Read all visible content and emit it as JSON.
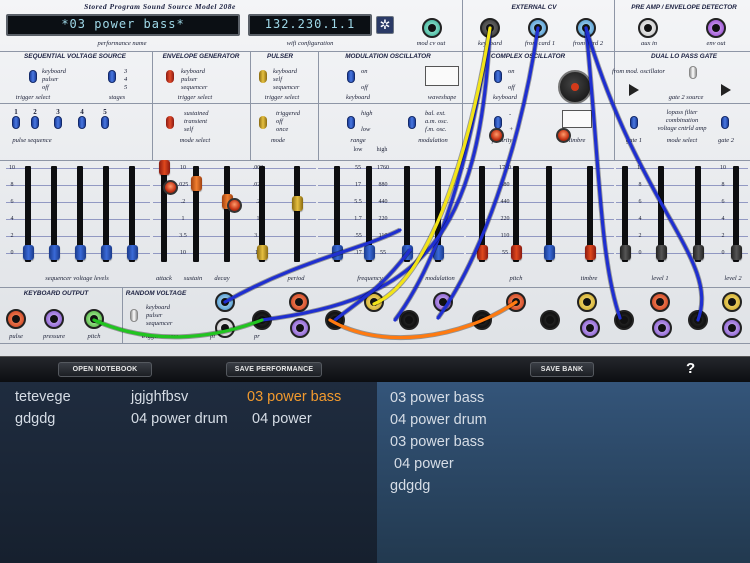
{
  "header": {
    "title": "Stored Program Sound Source Model 208e",
    "performance_name": "*03 power bass*",
    "performance_caption": "performance name",
    "wifi_address": "132.230.1.1",
    "wifi_caption": "wifi configuration",
    "gear_glyph": "✲",
    "mod_cv_out": "mod cv out"
  },
  "sections": {
    "external_cv": "EXTERNAL CV",
    "keyboard": "keyboard",
    "from_card_1": "from card 1",
    "from_card_2": "from card 2",
    "preamp": "PRE AMP / ENVELOPE DETECTOR",
    "aux_in": "aux in",
    "env_out": "env out",
    "dual_lopass": "DUAL LO PASS GATE",
    "from_mod_osc": "from mod. oscillator",
    "gate_2_source": "gate 2 source",
    "lopass_filter": "lopass filter",
    "combination": "combination",
    "vca": "voltage cntrld amp",
    "gate_1": "gate 1",
    "mode_select_lpg": "mode select",
    "gate_2": "gate 2",
    "seq_voltage_source": "SEQUENTIAL VOLTAGE SOURCE",
    "seq_keyboard": "keyboard",
    "seq_pulser": "pulser",
    "seq_off": "off",
    "trigger_select": "trigger select",
    "stage_3": "3",
    "stage_4": "4",
    "stage_5": "5",
    "stages": "stages",
    "pulse_sequence": "pulse sequence",
    "pulse_nums": [
      "1",
      "2",
      "3",
      "4",
      "5"
    ],
    "env_gen": "ENVELOPE GENERATOR",
    "env_keyboard": "keyboard",
    "env_pulser": "pulser",
    "env_sequencer": "sequencer",
    "env_trigger_select": "trigger select",
    "env_sustained": "sustained",
    "env_transient": "transient",
    "env_self": "self",
    "env_mode_select": "mode select",
    "pulser": "PULSER",
    "pul_keyboard": "keyboard",
    "pul_self": "self",
    "pul_sequencer": "sequencer",
    "pul_trigger_select": "trigger select",
    "pul_triggered": "triggered",
    "pul_off": "off",
    "pul_once": "once",
    "pul_mode": "mode",
    "mod_osc": "MODULATION OSCILLATOR",
    "mod_on": "on",
    "mod_off": "off",
    "mod_keyboard": "keyboard",
    "mod_waveshape": "waveshape",
    "mod_high": "high",
    "mod_low": "low",
    "mod_range": "range",
    "mod_bal": "bal. ext.",
    "mod_am": "a.m. osc.",
    "mod_fm": "f.m. osc.",
    "mod_modulation": "modulation",
    "complex_osc": "COMPLEX OSCILLATOR",
    "cx_on": "on",
    "cx_off": "off",
    "cx_keyboard": "keyboard",
    "cx_polarity": "polarity",
    "cx_minus": "-",
    "cx_plus": "+",
    "cx_timbre": "timbre",
    "keyboard_output": "KEYBOARD OUTPUT",
    "kb_pulse": "pulse",
    "kb_pressure": "pressure",
    "kb_pitch": "pitch",
    "random_voltage": "RANDOM VOLTAGE",
    "rv_keyboard": "keyboard",
    "rv_pulser": "pulser",
    "rv_sequencer": "sequencer",
    "rv_trigger": "trigger source"
  },
  "scales": {
    "seq": [
      "10",
      "8",
      "6",
      "4",
      "2",
      "0"
    ],
    "env": [
      "10",
      ".025",
      ".2",
      "1",
      "3.5",
      "10"
    ],
    "pul": [
      ".002",
      ".025",
      ".2",
      "1",
      "3.5",
      "10"
    ],
    "mod_low": [
      "55",
      "17",
      "5.5",
      "1.7",
      ".55",
      ".17"
    ],
    "mod_low_head": "low",
    "mod_high": [
      "1760",
      "880",
      "440",
      "220",
      "110",
      "55"
    ],
    "mod_high_head": "high",
    "cx": [
      "1760",
      "880",
      "440",
      "220",
      "110",
      "55"
    ],
    "r1": [
      "10",
      "8",
      "6",
      "4",
      "2",
      "0"
    ],
    "r2": [
      "10",
      "8",
      "6",
      "4",
      "2",
      "0"
    ]
  },
  "bottom_labels": {
    "seq_levels": "sequencer voltage levels",
    "attack": "attack",
    "sustain": "sustain",
    "decay": "decay",
    "period": "period",
    "frequency": "frequency",
    "modulation": "modulation",
    "pitch": "pitch",
    "timbre": "timbre",
    "level_1": "level 1",
    "level_2": "level 2",
    "pi_hint": "pi",
    "pr_hint": "pr"
  },
  "toolbar": {
    "open_notebook": "OPEN NOTEBOOK",
    "save_performance": "SAVE PERFORMANCE",
    "save_bank": "SAVE BANK",
    "help": "?"
  },
  "notebook": {
    "col1": [
      "tetevege",
      "gdgdg"
    ],
    "col2": [
      "jgjghfbsv",
      "04 power drum"
    ],
    "col3": [
      "03 power bass",
      "04 power"
    ],
    "selected": "03 power bass"
  },
  "bank": {
    "items": [
      "03 power bass",
      "04 power drum",
      "03 power bass",
      "04 power",
      "gdgdg"
    ]
  },
  "colors": {
    "selected_text": "#f29a2e",
    "item_text": "#d6dde6",
    "wire_blue": "#1f2fd0",
    "wire_yellow": "#f2e418",
    "wire_orange": "#ff7a10",
    "wire_green": "#21c420"
  }
}
